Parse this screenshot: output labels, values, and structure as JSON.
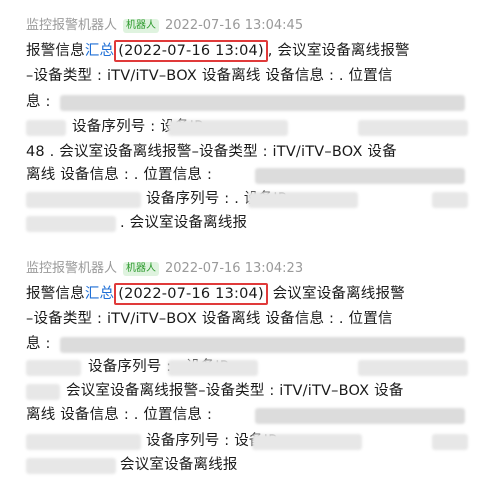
{
  "messages": [
    {
      "sender": "监控报警机器人",
      "badge": "机器人",
      "time": "2022-07-16 13:04:45",
      "lines": [
        {
          "a": "报警信息",
          "link": "汇总",
          "hl": "(2022-07-16 13:04)",
          "b": ", 会议室设备离线报警"
        },
        {
          "text": "–设备类型 : iTV/iTV–BOX 设备离线 设备信息 :   . 位置信"
        },
        {
          "text": "息 :"
        },
        {
          "text": "设备序列号 :                          设备IP."
        },
        {
          "text": "48 . 会议室设备离线报警–设备类型 : iTV/iTV–BOX 设备"
        },
        {
          "text": "离线 设备信息 :   . 位置信息 :"
        },
        {
          "text": "设备序列号 :                       . 设备IP :"
        },
        {
          "text": ". 会议室设备离线报"
        }
      ]
    },
    {
      "sender": "监控报警机器人",
      "badge": "机器人",
      "time": "2022-07-16 13:04:23",
      "lines": [
        {
          "a": "报警信息",
          "link": "汇总",
          "hl": "(2022-07-16 13:04)",
          "b": " 会议室设备离线报警"
        },
        {
          "text": "–设备类型 : iTV/iTV–BOX 设备离线 设备信息 :   . 位置信"
        },
        {
          "text": "息 :"
        },
        {
          "text": "设备序列号 :                  . 设备IP :"
        },
        {
          "text": "会议室设备离线报警–设备类型 : iTV/iTV–BOX 设备"
        },
        {
          "text": "离线 设备信息 :   . 位置信息 :"
        },
        {
          "text": "设备序列号 :                       设备IP :"
        },
        {
          "text": "会议室设备离线报"
        }
      ]
    }
  ]
}
